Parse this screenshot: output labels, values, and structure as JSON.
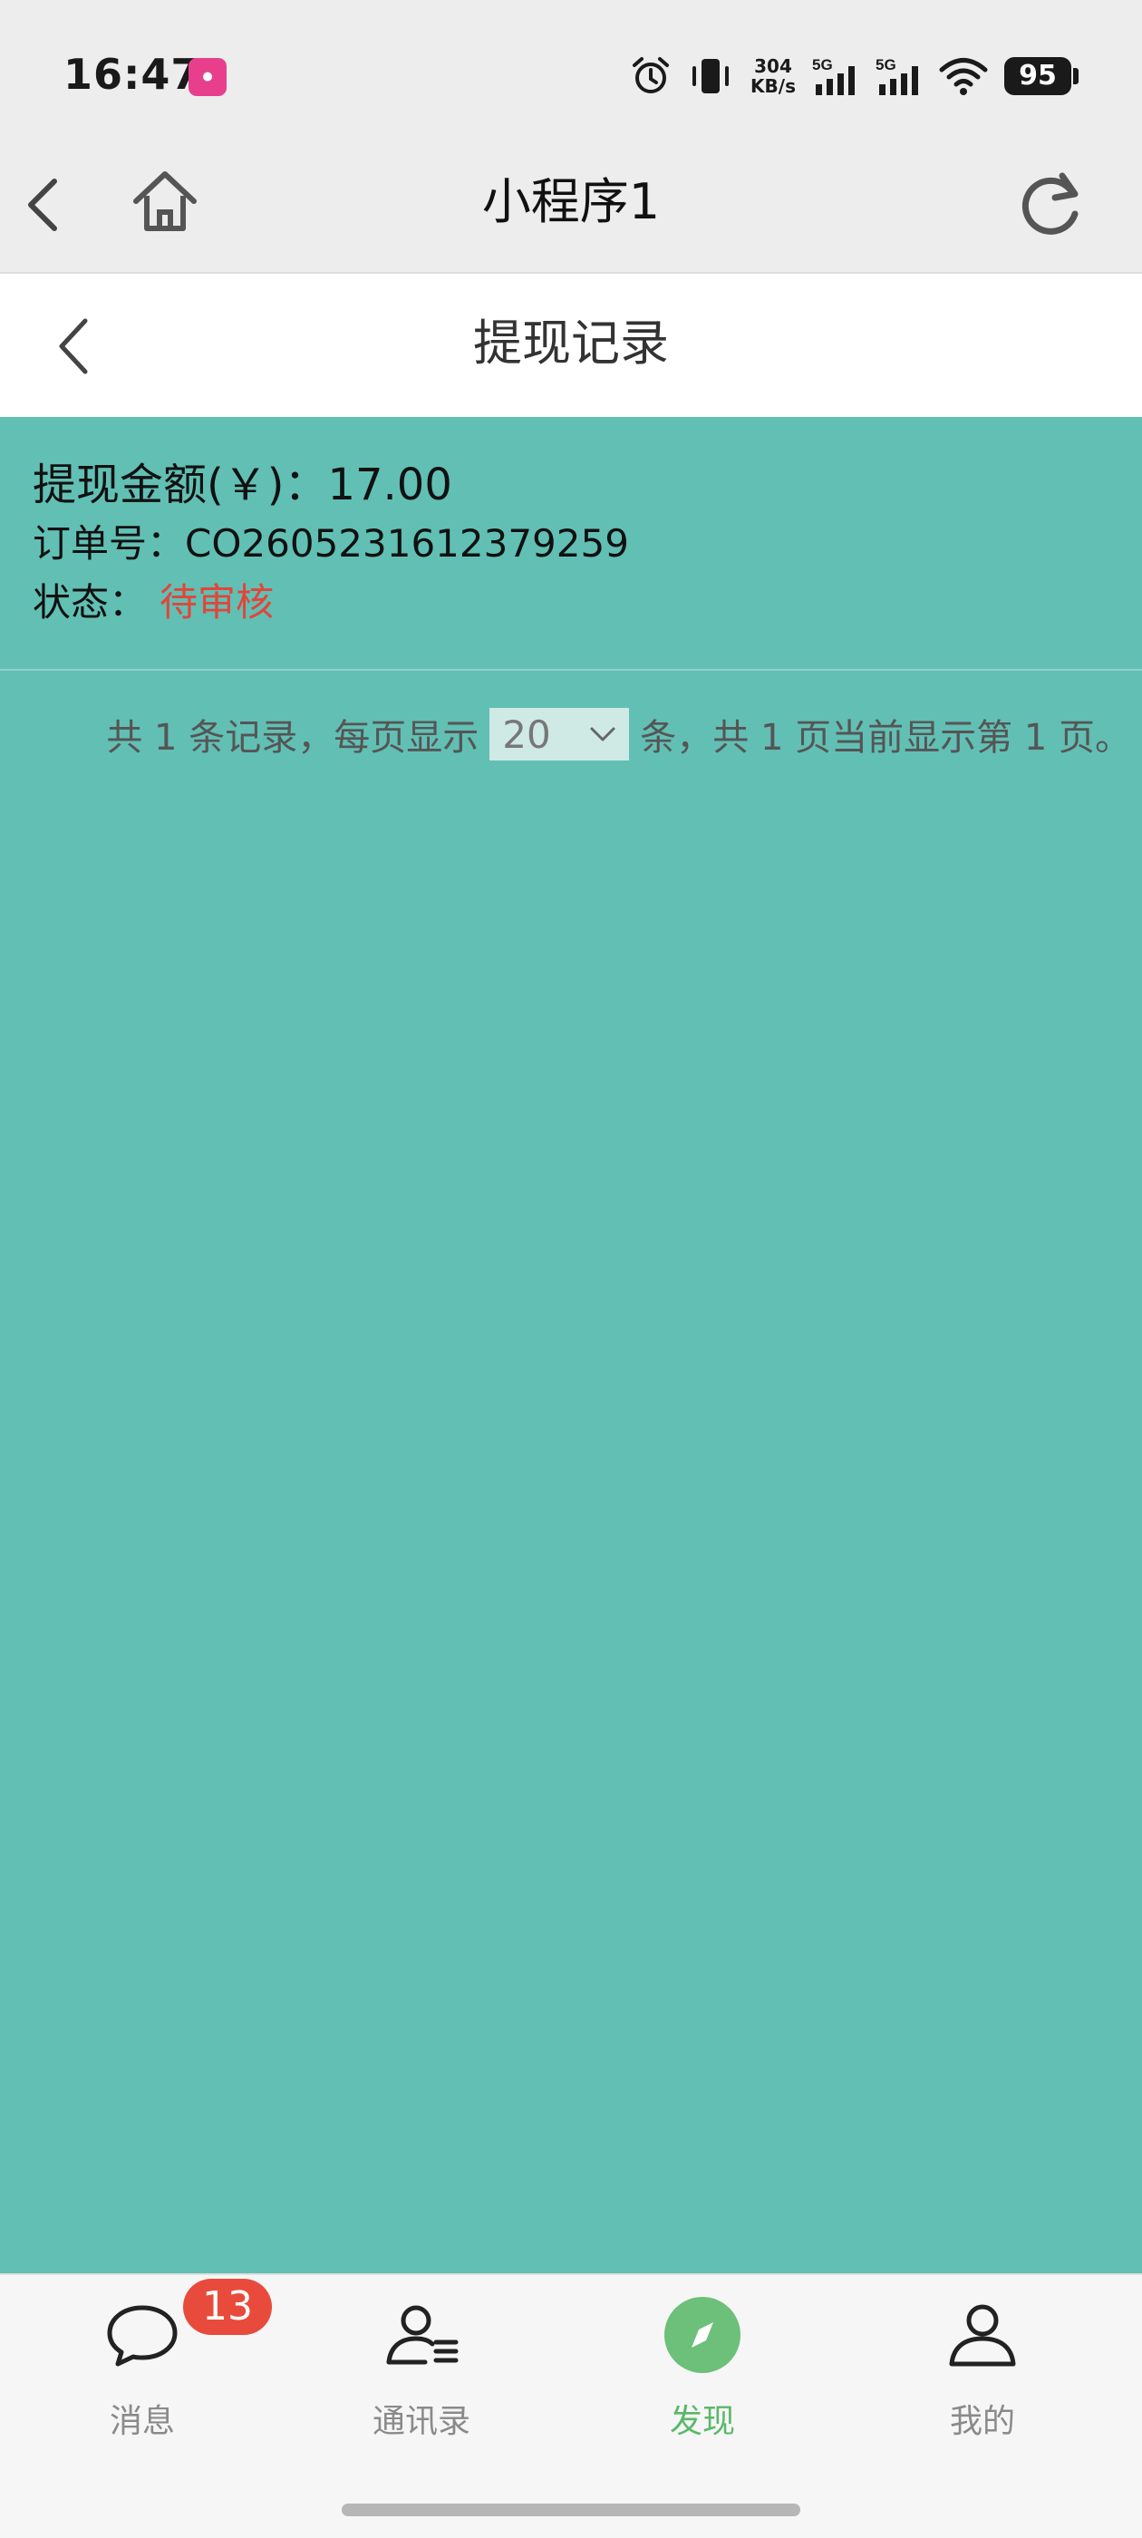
{
  "status_bar": {
    "time": "16:47",
    "app_notification_icon": "app-notification-icon",
    "icons": [
      "alarm-icon",
      "vibrate-icon",
      "signal-5g-icon",
      "signal-5g-icon",
      "wifi-icon"
    ],
    "net_speed_value": "304",
    "net_speed_unit": "KB/s",
    "network_1": "5G",
    "network_2": "5G",
    "battery": "95"
  },
  "mini_program_nav": {
    "title": "小程序1",
    "icons": [
      "back-arrow-icon",
      "home-icon",
      "refresh-icon"
    ]
  },
  "page_header": {
    "title": "提现记录",
    "icon": "back-arrow-icon"
  },
  "record": {
    "amount_label": "提现金额(￥)：",
    "amount_value": "17.00",
    "order_label": "订单号：",
    "order_value": "CO2605231612379259",
    "status_label": "状态：",
    "status_value": "待审核"
  },
  "pagination": {
    "text_before": "共 1 条记录，每页显示",
    "page_size": "20",
    "text_after": "条，共 1 页当前显示第 1 页。"
  },
  "tabbar": {
    "tabs": [
      {
        "label": "消息",
        "icon": "chat-bubble-icon",
        "badge": "13"
      },
      {
        "label": "通讯录",
        "icon": "contacts-icon"
      },
      {
        "label": "发现",
        "icon": "compass-icon",
        "active": true
      },
      {
        "label": "我的",
        "icon": "person-icon"
      }
    ]
  },
  "colors": {
    "background": "#62bfb4",
    "status_pending": "#e0463a",
    "active_tab": "#5bb86a",
    "badge": "#e84b3c"
  }
}
